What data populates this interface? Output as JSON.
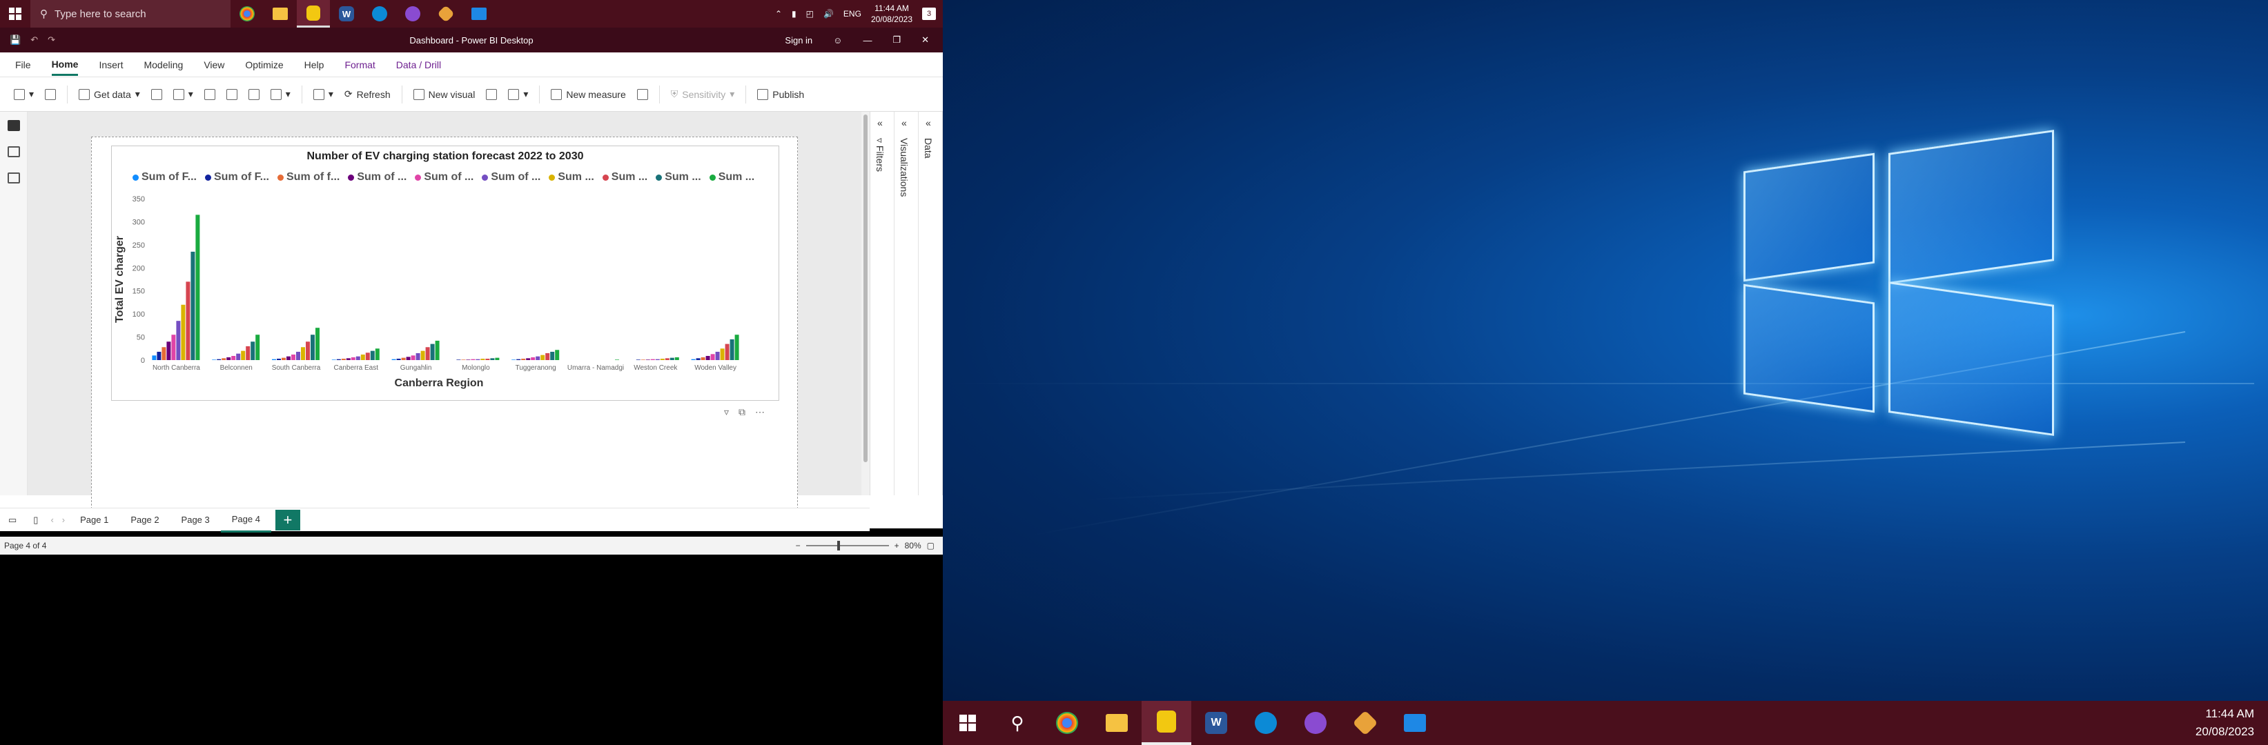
{
  "taskbar_left": {
    "search_placeholder": "Type here to search",
    "tray_lang": "ENG",
    "time": "11:44 AM",
    "date": "20/08/2023",
    "notif_count": "3"
  },
  "window": {
    "title": "Dashboard - Power BI Desktop",
    "signin": "Sign in"
  },
  "menu": {
    "tabs": [
      "File",
      "Home",
      "Insert",
      "Modeling",
      "View",
      "Optimize",
      "Help",
      "Format",
      "Data / Drill"
    ]
  },
  "ribbon": {
    "get_data": "Get data",
    "refresh": "Refresh",
    "new_visual": "New visual",
    "new_measure": "New measure",
    "sensitivity": "Sensitivity",
    "publish": "Publish"
  },
  "panes": {
    "filters": "Filters",
    "visualizations": "Visualizations",
    "data": "Data"
  },
  "pages": {
    "tabs": [
      "Page 1",
      "Page 2",
      "Page 3",
      "Page 4"
    ],
    "active": "Page 4",
    "add": "+"
  },
  "status": {
    "page_info": "Page 4 of 4",
    "zoom": "80%"
  },
  "taskbar_right": {
    "time": "11:44 AM",
    "date": "20/08/2023"
  },
  "chart_data": {
    "type": "bar",
    "title": "Number of EV charging station forecast 2022 to 2030",
    "xlabel": "Canberra Region",
    "ylabel": "Total EV charger",
    "ylim": [
      0,
      350
    ],
    "yticks": [
      0,
      50,
      100,
      150,
      200,
      250,
      300,
      350
    ],
    "legend_placement": "top",
    "categories": [
      "North Canberra",
      "Belconnen",
      "South Canberra",
      "Canberra East",
      "Gungahlin",
      "Molonglo",
      "Tuggeranong",
      "Umarra - Namadgi",
      "Weston Creek",
      "Woden Valley"
    ],
    "series": [
      {
        "name": "Sum of F...",
        "color": "#118DFF",
        "values": [
          10,
          1,
          2,
          1,
          2,
          0,
          1,
          0,
          0,
          2
        ]
      },
      {
        "name": "Sum of F...",
        "color": "#12239E",
        "values": [
          18,
          2,
          3,
          2,
          3,
          1,
          2,
          0,
          1,
          4
        ]
      },
      {
        "name": "Sum of f...",
        "color": "#E66C37",
        "values": [
          28,
          4,
          5,
          3,
          5,
          1,
          3,
          0,
          1,
          6
        ]
      },
      {
        "name": "Sum of ...",
        "color": "#6B007B",
        "values": [
          40,
          6,
          8,
          4,
          7,
          1,
          4,
          0,
          1,
          9
        ]
      },
      {
        "name": "Sum of ...",
        "color": "#E044A7",
        "values": [
          55,
          9,
          12,
          6,
          10,
          2,
          6,
          0,
          2,
          13
        ]
      },
      {
        "name": "Sum of ...",
        "color": "#744EC2",
        "values": [
          85,
          14,
          18,
          8,
          15,
          2,
          8,
          0,
          2,
          18
        ]
      },
      {
        "name": "Sum ...",
        "color": "#D9B300",
        "values": [
          120,
          20,
          28,
          12,
          20,
          3,
          11,
          0,
          3,
          25
        ]
      },
      {
        "name": "Sum ...",
        "color": "#D64550",
        "values": [
          170,
          30,
          40,
          16,
          28,
          3,
          15,
          0,
          4,
          35
        ]
      },
      {
        "name": "Sum ...",
        "color": "#197278",
        "values": [
          235,
          40,
          55,
          20,
          35,
          4,
          18,
          0,
          5,
          45
        ]
      },
      {
        "name": "Sum ...",
        "color": "#1AAB40",
        "values": [
          315,
          55,
          70,
          25,
          42,
          5,
          22,
          1,
          6,
          55
        ]
      }
    ]
  }
}
